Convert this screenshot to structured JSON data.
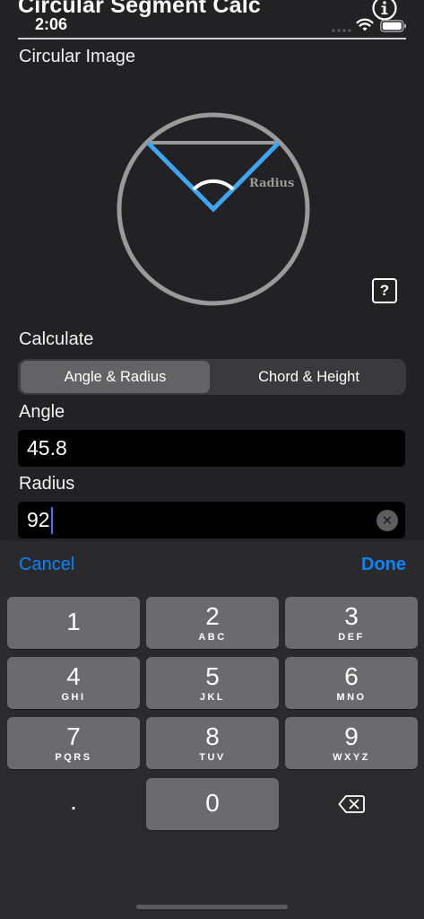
{
  "app": {
    "title": "Circular Segment Calc",
    "status_time": "2:06"
  },
  "image_section": {
    "label": "Circular Image",
    "radius_label": "Radius",
    "help_label": "?"
  },
  "calculate_section": {
    "label": "Calculate",
    "options": [
      "Angle & Radius",
      "Chord & Height"
    ],
    "selected": "Angle & Radius"
  },
  "fields": {
    "angle": {
      "label": "Angle",
      "value": "45.8"
    },
    "radius": {
      "label": "Radius",
      "value": "92"
    }
  },
  "accessory": {
    "cancel": "Cancel",
    "done": "Done"
  },
  "keypad": {
    "keys": [
      {
        "num": "1",
        "letters": ""
      },
      {
        "num": "2",
        "letters": "ABC"
      },
      {
        "num": "3",
        "letters": "DEF"
      },
      {
        "num": "4",
        "letters": "GHI"
      },
      {
        "num": "5",
        "letters": "JKL"
      },
      {
        "num": "6",
        "letters": "MNO"
      },
      {
        "num": "7",
        "letters": "PQRS"
      },
      {
        "num": "8",
        "letters": "TUV"
      },
      {
        "num": "9",
        "letters": "WXYZ"
      },
      {
        "num": ".",
        "letters": ""
      },
      {
        "num": "0",
        "letters": ""
      }
    ]
  },
  "colors": {
    "accent": "#0a84ff",
    "diagram_blue": "#3ea6f0",
    "diagram_gray": "#9a9a9a"
  },
  "icons": [
    "info-icon",
    "wifi-icon",
    "battery-icon",
    "help-icon",
    "clear-icon",
    "backspace-icon"
  ]
}
